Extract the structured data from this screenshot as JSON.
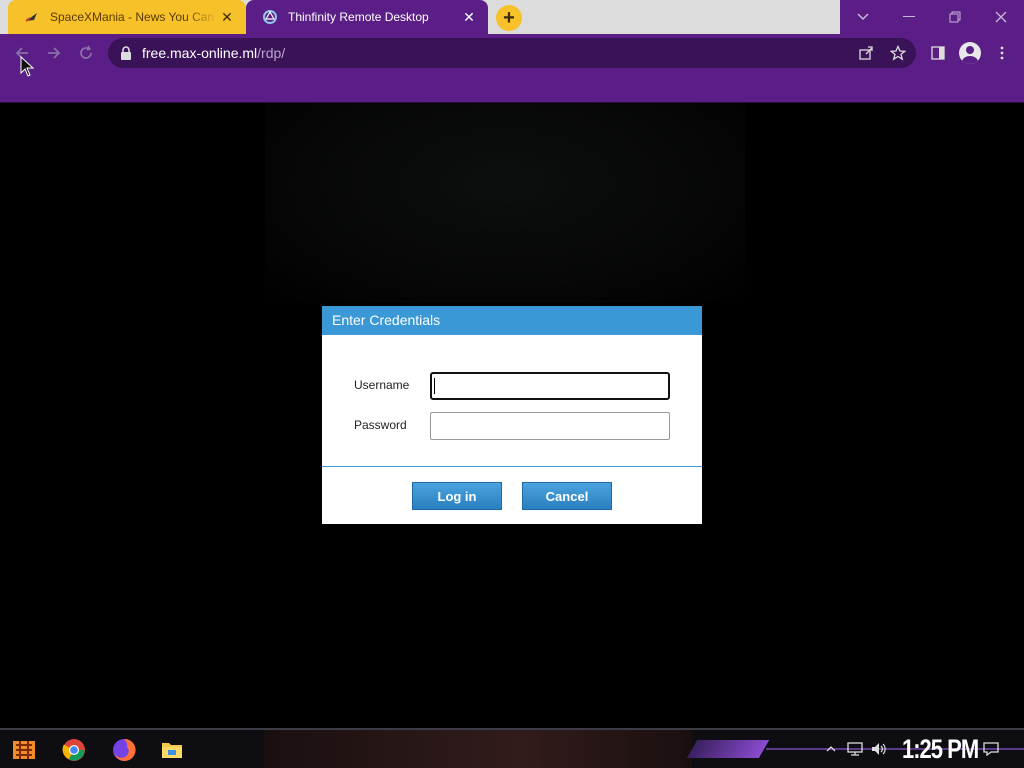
{
  "browser": {
    "tabs": [
      {
        "title": "SpaceXMania - News You Can T",
        "favicon": "rocket-icon"
      },
      {
        "title": "Thinfinity Remote Desktop",
        "favicon": "thinfinity-icon"
      }
    ],
    "url": {
      "domain": "free.max-online.ml",
      "path": "/rdp/"
    },
    "colors": {
      "accent": "#5b1e86",
      "active_tab": "#f7c12a"
    }
  },
  "dialog": {
    "title": "Enter Credentials",
    "username_label": "Username",
    "password_label": "Password",
    "username_value": "",
    "password_value": "",
    "login_label": "Log in",
    "cancel_label": "Cancel",
    "header_color": "#3a98d6"
  },
  "taskbar": {
    "clock": "1:25 PM",
    "pinned": [
      "start-icon",
      "chrome-icon",
      "firefox-icon",
      "file-explorer-icon"
    ],
    "tray": [
      "chevron-up-icon",
      "network-icon",
      "volume-icon",
      "notification-icon"
    ]
  }
}
